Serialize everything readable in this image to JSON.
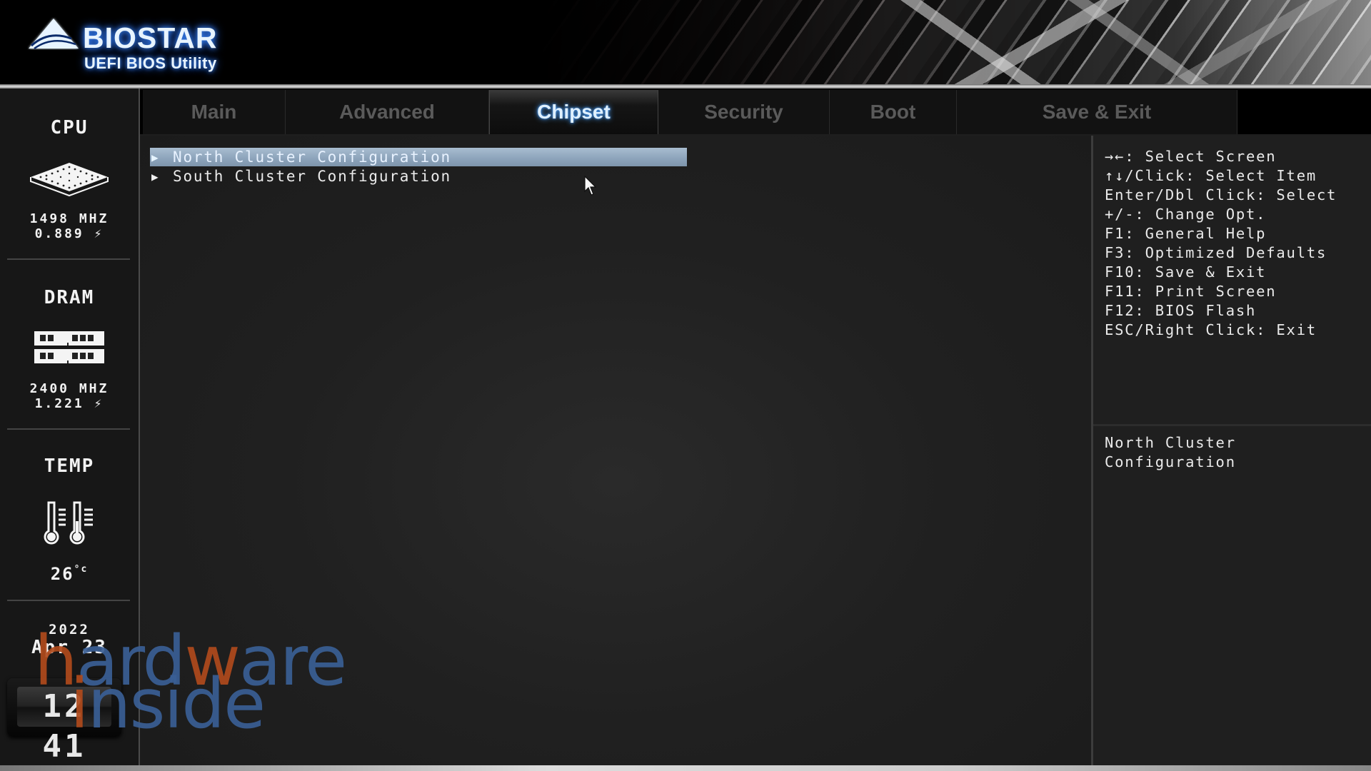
{
  "header": {
    "brand": "BIOSTAR",
    "product": "UEFI BIOS Utility"
  },
  "tabs": [
    {
      "label": "Main",
      "active": false
    },
    {
      "label": "Advanced",
      "active": false
    },
    {
      "label": "Chipset",
      "active": true
    },
    {
      "label": "Security",
      "active": false
    },
    {
      "label": "Boot",
      "active": false
    },
    {
      "label": "Save & Exit",
      "active": false
    }
  ],
  "sidebar": {
    "cpu": {
      "label": "CPU",
      "frequency": "1498 MHZ",
      "voltage": "0.889",
      "icon": "cpu-chip-icon"
    },
    "dram": {
      "label": "DRAM",
      "frequency": "2400 MHZ",
      "voltage": "1.221",
      "icon": "memory-module-icon"
    },
    "temp": {
      "label": "TEMP",
      "value": "26",
      "unit": "°c",
      "icon": "thermometer-icon"
    },
    "date": {
      "year": "2022",
      "month_day": "Apr 23"
    },
    "clock": {
      "time": "12 41"
    }
  },
  "main": {
    "items": [
      {
        "label": "North Cluster Configuration",
        "selected": true
      },
      {
        "label": "South Cluster Configuration",
        "selected": false
      }
    ]
  },
  "help": {
    "keys": [
      "→←: Select Screen",
      "↑↓/Click: Select Item",
      "Enter/Dbl Click: Select",
      "+/-: Change Opt.",
      "F1: General Help",
      "F3: Optimized Defaults",
      "F10: Save & Exit",
      "F11: Print Screen",
      "F12: BIOS Flash",
      "ESC/Right Click: Exit"
    ],
    "description": [
      "North Cluster",
      "Configuration"
    ]
  },
  "watermark": {
    "line1_accent_h": "h",
    "line1_a": "ard",
    "line1_w": "w",
    "line1_b": "are",
    "line2_i": "i",
    "line2_rest": "nside"
  },
  "colors": {
    "selection": "#8ea5bc",
    "active_tab_glow": "#4aa0ff",
    "inactive_tab_text": "#5a5a5a",
    "watermark_blue": "#3a5f95",
    "watermark_orange": "#b04a1c"
  }
}
